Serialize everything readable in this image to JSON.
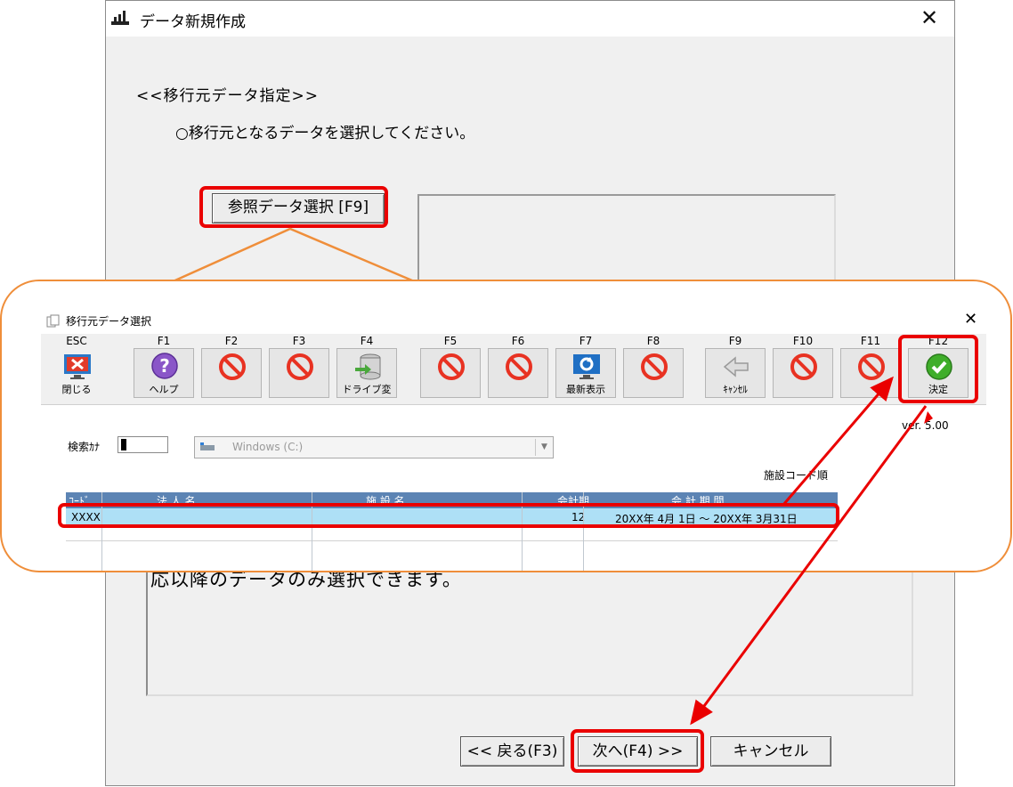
{
  "window": {
    "title": "データ新規作成",
    "close_glyph": "✕",
    "heading": "<<移行元データ指定>>",
    "instruction": "○移行元となるデータを選択してください。",
    "ref_button": "参照データ選択 [F9]",
    "message": "応以降のデータのみ選択できます。",
    "back_button": "<< 戻る(F3)",
    "next_button": "次へ(F4) >>",
    "cancel_button": "キャンセル"
  },
  "dialog": {
    "title": "移行元データ選択",
    "close_glyph": "✕",
    "toolbar": [
      {
        "key": "ESC",
        "label": "閉じる",
        "icon": "close-monitor-icon"
      },
      {
        "key": "F1",
        "label": "ヘルプ",
        "icon": "help-icon"
      },
      {
        "key": "F2",
        "label": "",
        "icon": "disabled-icon"
      },
      {
        "key": "F3",
        "label": "",
        "icon": "disabled-icon"
      },
      {
        "key": "F4",
        "label": "ドライブ変",
        "icon": "drive-change-icon"
      },
      {
        "key": "F5",
        "label": "",
        "icon": "disabled-icon"
      },
      {
        "key": "F6",
        "label": "",
        "icon": "disabled-icon"
      },
      {
        "key": "F7",
        "label": "最新表示",
        "icon": "refresh-icon"
      },
      {
        "key": "F8",
        "label": "",
        "icon": "disabled-icon"
      },
      {
        "key": "F9",
        "label": "ｷｬﾝｾﾙ",
        "icon": "back-arrow-icon"
      },
      {
        "key": "F10",
        "label": "",
        "icon": "disabled-icon"
      },
      {
        "key": "F11",
        "label": "",
        "icon": "disabled-icon"
      },
      {
        "key": "F12",
        "label": "決定",
        "icon": "check-icon"
      }
    ],
    "version": "ver. 5.00",
    "search_label": "検索ｶﾅ",
    "search_value": "",
    "drive": "Windows (C:)",
    "sort_label": "施設コード順",
    "columns": {
      "code": "ｺｰﾄﾞ",
      "corp": "法 人 名",
      "facility": "施 設 名",
      "period_no": "会計期",
      "period": "会 計 期 間"
    },
    "row": {
      "code": "XXXX",
      "corp": "",
      "facility": "",
      "period_no": "12",
      "period": "20XX年 4月 1日 ～ 20XX年 3月31日"
    }
  },
  "colors": {
    "highlight": "#ea0000",
    "callout": "#ef8e3a",
    "table_header": "#5c84b4",
    "selected_row": "#aee0f6"
  }
}
